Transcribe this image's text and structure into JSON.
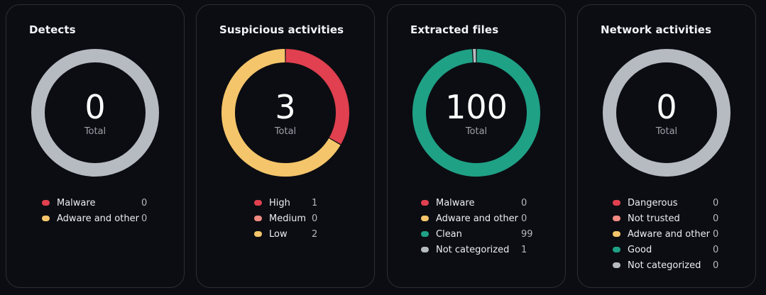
{
  "cards": [
    {
      "title": "Detects",
      "total": "0",
      "total_label": "Total",
      "segments": [
        {
          "value": 1,
          "color": "#b6bbc2"
        }
      ],
      "legend": [
        {
          "label": "Malware",
          "count": "0",
          "color": "#e0404f"
        },
        {
          "label": "Adware and other",
          "count": "0",
          "color": "#f4c56a"
        }
      ]
    },
    {
      "title": "Suspicious activities",
      "total": "3",
      "total_label": "Total",
      "segments": [
        {
          "value": 1,
          "color": "#e0404f"
        },
        {
          "value": 0,
          "color": "#f08a82"
        },
        {
          "value": 2,
          "color": "#f4c56a"
        }
      ],
      "legend": [
        {
          "label": "High",
          "count": "1",
          "color": "#e0404f"
        },
        {
          "label": "Medium",
          "count": "0",
          "color": "#f08a82"
        },
        {
          "label": "Low",
          "count": "2",
          "color": "#f4c56a"
        }
      ]
    },
    {
      "title": "Extracted files",
      "total": "100",
      "total_label": "Total",
      "segments": [
        {
          "value": 0,
          "color": "#e0404f"
        },
        {
          "value": 0,
          "color": "#f4c56a"
        },
        {
          "value": 99,
          "color": "#1fa186"
        },
        {
          "value": 1,
          "color": "#b6bbc2"
        }
      ],
      "legend": [
        {
          "label": "Malware",
          "count": "0",
          "color": "#e0404f"
        },
        {
          "label": "Adware and other",
          "count": "0",
          "color": "#f4c56a"
        },
        {
          "label": "Clean",
          "count": "99",
          "color": "#1fa186"
        },
        {
          "label": "Not categorized",
          "count": "1",
          "color": "#b6bbc2"
        }
      ]
    },
    {
      "title": "Network activities",
      "total": "0",
      "total_label": "Total",
      "segments": [
        {
          "value": 1,
          "color": "#b6bbc2"
        }
      ],
      "legend": [
        {
          "label": "Dangerous",
          "count": "0",
          "color": "#e0404f"
        },
        {
          "label": "Not trusted",
          "count": "0",
          "color": "#f08a82"
        },
        {
          "label": "Adware and other",
          "count": "0",
          "color": "#f4c56a"
        },
        {
          "label": "Good",
          "count": "0",
          "color": "#1fa186"
        },
        {
          "label": "Not categorized",
          "count": "0",
          "color": "#b6bbc2"
        }
      ]
    }
  ]
}
